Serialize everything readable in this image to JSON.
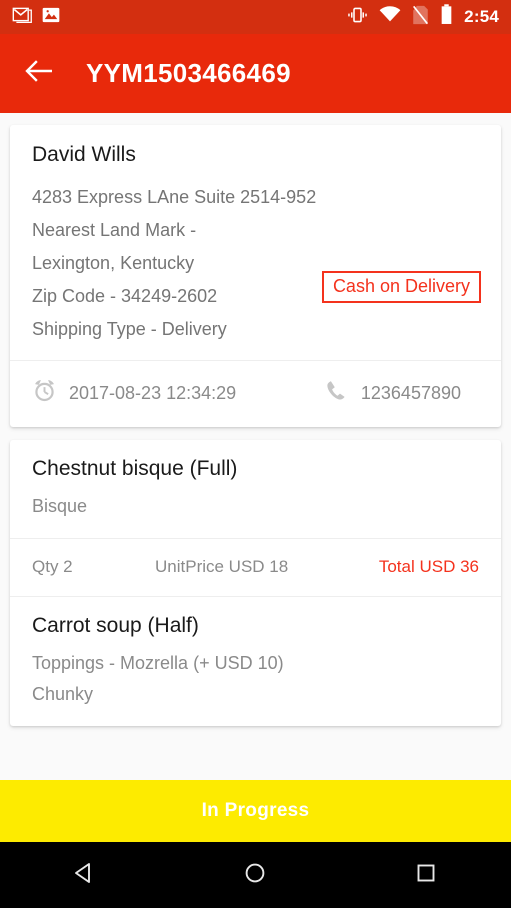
{
  "status_bar": {
    "time": "2:54",
    "left_icons": [
      "gmail-icon",
      "photo-icon"
    ],
    "right_icons": [
      "vibrate-icon",
      "wifi-icon",
      "no-sim-icon",
      "battery-icon"
    ]
  },
  "app_bar": {
    "back_icon": "back-arrow-icon",
    "title": "YYM1503466469"
  },
  "colors": {
    "app_bar_red": "#e8290b",
    "status_bar_red": "#d32f10",
    "accent_red": "#f4321d",
    "progress_yellow": "#fdeb00",
    "page_background": "#fafafa"
  },
  "address_card": {
    "customer_name": "David Wills",
    "address_lines": [
      "4283 Express LAne Suite 2514-952",
      "Nearest Land Mark -",
      "Lexington, Kentucky",
      "Zip Code - 34249-2602",
      "Shipping Type - Delivery"
    ],
    "payment_badge": "Cash on Delivery",
    "timestamp": "2017-08-23 12:34:29",
    "timestamp_icon": "alarm-clock-icon",
    "phone": "1236457890",
    "phone_icon": "phone-icon"
  },
  "items": [
    {
      "name": "Chestnut bisque (Full)",
      "sub_lines": [
        "Bisque"
      ],
      "qty": "Qty 2",
      "unit_price": "UnitPrice USD 18",
      "total": "Total USD 36"
    },
    {
      "name": "Carrot soup (Half)",
      "sub_lines": [
        "Toppings - Mozrella (+ USD 10)",
        "Chunky"
      ]
    }
  ],
  "order_status": {
    "label": "In Progress"
  },
  "nav_bar": {
    "back": "nav-back-icon",
    "home": "nav-home-icon",
    "recents": "nav-recents-icon"
  }
}
